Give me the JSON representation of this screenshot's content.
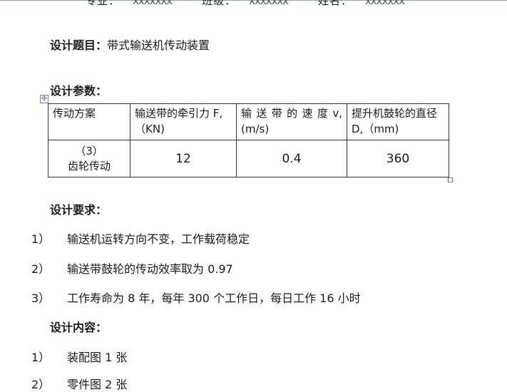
{
  "header": {
    "major_label": "专业：",
    "major_value": "xxxxxxx",
    "class_label": "班级：",
    "class_value": "xxxxxxx",
    "name_label": "姓名：",
    "name_value": "xxxxxxx"
  },
  "topic": {
    "label": "设计题目：",
    "value": "带式输送机传动装置"
  },
  "params": {
    "label": "设计参数：",
    "table_anchor_icon": "move-table-icon",
    "headers": [
      "传动方案",
      "输送带的牵引力 F,（KN)",
      "输 送 带 的 速 度 v,(m/s)",
      "提升机鼓轮的直径 D,（mm)"
    ],
    "row": {
      "scheme_line1": "（3）",
      "scheme_line2": "齿轮传动",
      "force": "12",
      "speed": "0.4",
      "diameter": "360"
    }
  },
  "requirements": {
    "label": "设计要求：",
    "items": [
      {
        "num": "1）",
        "text": "输送机运转方向不变，工作载荷稳定"
      },
      {
        "num": "2）",
        "text": "输送带鼓轮的传动效率取为 0.97"
      },
      {
        "num": "3）",
        "text": "工作寿命为 8 年，每年 300 个工作日，每日工作 16 小时"
      }
    ]
  },
  "content": {
    "label": "设计内容：",
    "items": [
      {
        "num": "1）",
        "text": "装配图 1 张"
      },
      {
        "num": "2）",
        "text": "零件图 2 张"
      }
    ]
  }
}
